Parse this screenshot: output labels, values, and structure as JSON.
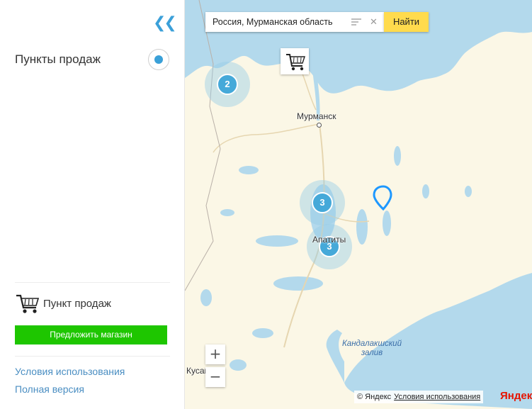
{
  "sidebar": {
    "collapse_icon": "double-chevron-left",
    "layer_title": "Пункты продаж",
    "layer_enabled": true,
    "legend": {
      "icon": "shopping-cart-icon",
      "label": "Пункт продаж"
    },
    "suggest_button": "Предложить магазин",
    "links": {
      "terms": "Условия использования",
      "full_version": "Полная версия"
    }
  },
  "search": {
    "value": "Россия, Мурманская область",
    "find_button": "Найти"
  },
  "map": {
    "clusters": [
      {
        "count": "2"
      },
      {
        "count": "3"
      },
      {
        "count": "3"
      }
    ],
    "cities": {
      "murmansk": "Мурманск",
      "apatity": "Апатиты",
      "kusamo": "Кусамо"
    },
    "water": {
      "kandalaksha_line1": "Кандалакшский",
      "kandalaksha_line2": "залив"
    },
    "zoom_in": "+",
    "zoom_out": "−"
  },
  "footer": {
    "copyright": "© Яндекс",
    "terms": "Условия использования",
    "logo": "Яндекс"
  },
  "colors": {
    "land": "#fbf7e6",
    "water": "#b3d9ec",
    "accent": "#3ba0d9",
    "suggest_green": "#1ec600",
    "find_yellow": "#ffdb4d"
  }
}
